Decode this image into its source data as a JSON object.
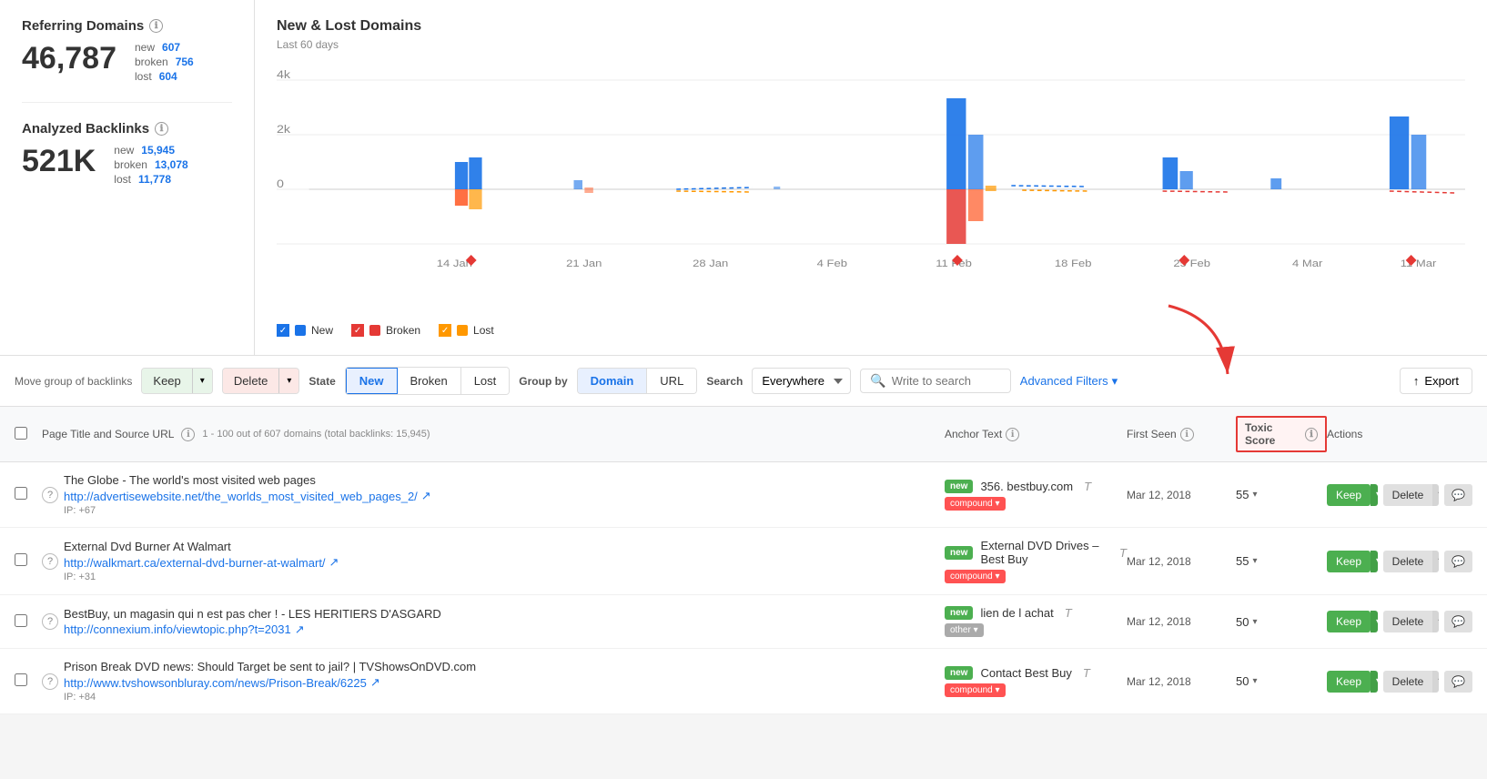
{
  "stats": {
    "referring_domains": {
      "title": "Referring Domains",
      "main_number": "46,787",
      "new_label": "new",
      "new_value": "607",
      "broken_label": "broken",
      "broken_value": "756",
      "lost_label": "lost",
      "lost_value": "604"
    },
    "analyzed_backlinks": {
      "title": "Analyzed Backlinks",
      "main_number": "521K",
      "new_label": "new",
      "new_value": "15,945",
      "broken_label": "broken",
      "broken_value": "13,078",
      "lost_label": "lost",
      "lost_value": "11,778"
    }
  },
  "chart": {
    "title": "New & Lost Domains",
    "subtitle": "Last 60 days",
    "legend": {
      "new_label": "New",
      "broken_label": "Broken",
      "lost_label": "Lost"
    },
    "x_labels": [
      "14 Jan",
      "21 Jan",
      "28 Jan",
      "4 Feb",
      "11 Feb",
      "18 Feb",
      "25 Feb",
      "4 Mar",
      "11 Mar"
    ],
    "y_labels": [
      "4k",
      "2k",
      "0"
    ]
  },
  "filters": {
    "move_group_label": "Move group of backlinks",
    "keep_label": "Keep",
    "delete_label": "Delete",
    "state_label": "State",
    "new_btn": "New",
    "broken_btn": "Broken",
    "lost_btn": "Lost",
    "groupby_label": "Group by",
    "domain_btn": "Domain",
    "url_btn": "URL",
    "search_label": "Search",
    "search_placeholder": "Write to search",
    "everywhere_option": "Everywhere",
    "advanced_filters": "Advanced Filters",
    "export_btn": "Export"
  },
  "table": {
    "col_page_title": "Page Title and Source URL",
    "col_count_info": "1 - 100 out of 607 domains (total backlinks: 15,945)",
    "col_anchor": "Anchor Text",
    "col_first_seen": "First Seen",
    "col_toxic": "Toxic Score",
    "col_actions": "Actions",
    "rows": [
      {
        "id": 1,
        "title": "The Globe - The world's most visited web pages",
        "url": "http://advertisewebsite.net/the_worlds_most_visited_web_pages_2/",
        "ip": "IP: +67",
        "anchor_badge": "new",
        "anchor_text": "356. bestbuy.com",
        "anchor_type": "compound",
        "first_seen": "Mar 12, 2018",
        "toxic_score": "55",
        "has_t_icon": true
      },
      {
        "id": 2,
        "title": "External Dvd Burner At Walmart",
        "url": "http://walkmart.ca/external-dvd-burner-at-walmart/",
        "ip": "IP: +31",
        "anchor_badge": "new",
        "anchor_text": "External DVD Drives – Best Buy",
        "anchor_type": "compound",
        "first_seen": "Mar 12, 2018",
        "toxic_score": "55",
        "has_t_icon": true
      },
      {
        "id": 3,
        "title": "BestBuy, un magasin qui n est pas cher ! - LES HERITIERS D'ASGARD",
        "url": "http://connexium.info/viewtopic.php?t=2031",
        "ip": "",
        "anchor_badge": "new",
        "anchor_text": "lien de l achat",
        "anchor_type": "other",
        "first_seen": "Mar 12, 2018",
        "toxic_score": "50",
        "has_t_icon": true
      },
      {
        "id": 4,
        "title": "Prison Break DVD news: Should Target be sent to jail? | TVShowsOnDVD.com",
        "url": "http://www.tvshowsonbluray.com/news/Prison-Break/6225",
        "ip": "IP: +84",
        "anchor_badge": "new",
        "anchor_text": "Contact Best Buy",
        "anchor_type": "compound",
        "first_seen": "Mar 12, 2018",
        "toxic_score": "50",
        "has_t_icon": true
      }
    ]
  },
  "icons": {
    "info": "ℹ",
    "checkmark": "✓",
    "chevron_down": "▾",
    "external_link": "↗",
    "search": "🔍",
    "export": "↑",
    "chat": "💬",
    "help": "?"
  }
}
